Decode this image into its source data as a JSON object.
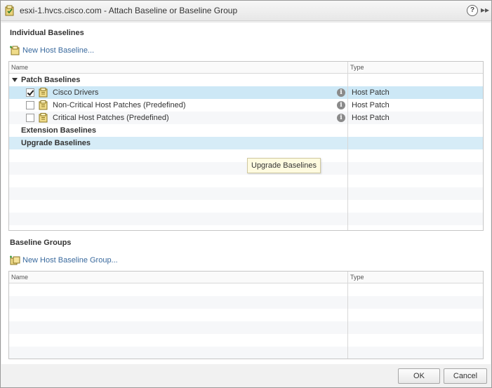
{
  "window": {
    "title": "esxi-1.hvcs.cisco.com - Attach Baseline or Baseline Group",
    "help_glyph": "?",
    "expand_glyph": "▸▸"
  },
  "individual": {
    "header": "Individual Baselines",
    "new_link": "New Host Baseline...",
    "columns": {
      "name": "Name",
      "type": "Type"
    },
    "patch_group": "Patch Baselines",
    "rows": [
      {
        "name": "Cisco Drivers",
        "type": "Host Patch",
        "checked": true
      },
      {
        "name": "Non-Critical Host Patches (Predefined)",
        "type": "Host Patch",
        "checked": false
      },
      {
        "name": "Critical Host Patches (Predefined)",
        "type": "Host Patch",
        "checked": false
      }
    ],
    "extension_group": "Extension Baselines",
    "upgrade_group": "Upgrade Baselines",
    "tooltip": "Upgrade Baselines",
    "info_glyph": "i"
  },
  "groups": {
    "header": "Baseline Groups",
    "new_link": "New Host Baseline Group...",
    "columns": {
      "name": "Name",
      "type": "Type"
    }
  },
  "buttons": {
    "ok": "OK",
    "cancel": "Cancel"
  },
  "colors": {
    "link": "#3a6a9e",
    "selection": "#cde8f6",
    "tooltip_bg": "#fffbe0"
  }
}
